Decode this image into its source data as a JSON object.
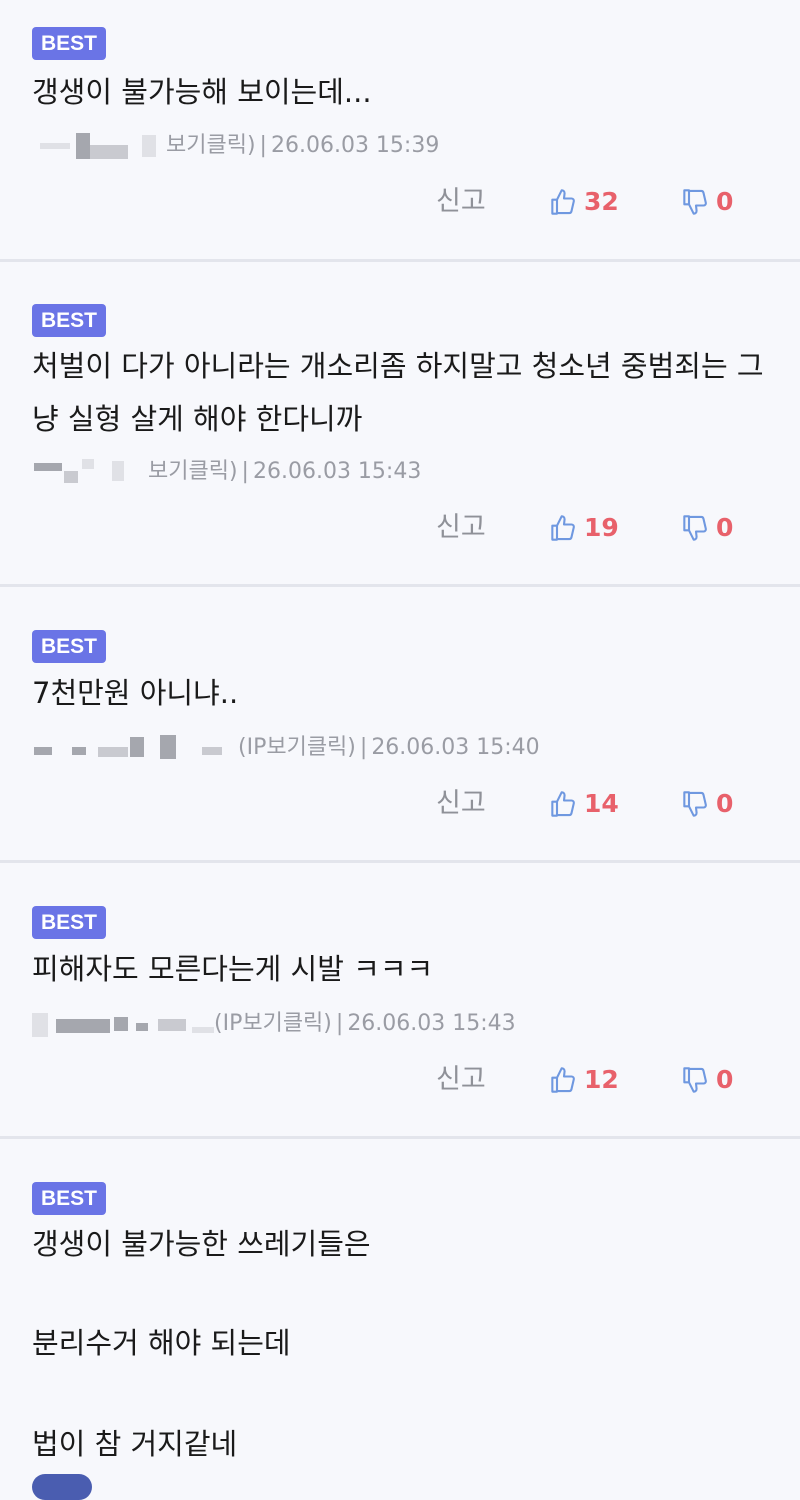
{
  "badge_label": "BEST",
  "report_label": "신고",
  "icons": {
    "like": "thumbs-up-icon",
    "dislike": "thumbs-down-icon"
  },
  "colors": {
    "badge": "#6a74e6",
    "count": "#e8616b",
    "icon": "#6f98e0"
  },
  "comments": [
    {
      "text": "갱생이 불가능해 보이는데...",
      "ip_note": "보기클릭)",
      "date": "26.06.03 15:39",
      "likes": "32",
      "dislikes": "0"
    },
    {
      "text": "처벌이 다가 아니라는 개소리좀 하지말고 청소년 중범죄는 그냥 실형 살게 해야 한다니까",
      "ip_note": "보기클릭)",
      "date": "26.06.03 15:43",
      "likes": "19",
      "dislikes": "0"
    },
    {
      "text": "7천만원 아니냐..",
      "ip_note": "(IP보기클릭)",
      "date": "26.06.03 15:40",
      "likes": "14",
      "dislikes": "0"
    },
    {
      "text": "피해자도 모른다는게 시발 ㅋㅋㅋ",
      "ip_note": "(IP보기클릭)",
      "date": "26.06.03 15:43",
      "likes": "12",
      "dislikes": "0"
    },
    {
      "text_lines": [
        "갱생이 불가능한 쓰레기들은",
        "분리수거 해야 되는데",
        "법이 참 거지같네"
      ]
    }
  ]
}
